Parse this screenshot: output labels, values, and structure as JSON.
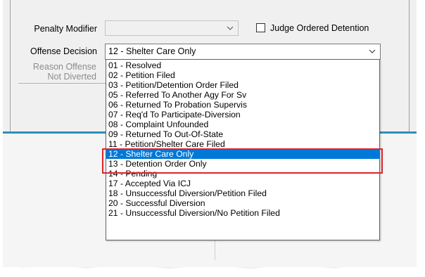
{
  "form": {
    "penalty_modifier_label": "Penalty Modifier",
    "penalty_modifier_value": "",
    "judge_ordered_label": "Judge Ordered Detention",
    "offense_decision_label": "Offense Decision",
    "offense_decision_value": "12 - Shelter Care Only",
    "reason_label_line1": "Reason Offense",
    "reason_label_line2": "Not Diverted"
  },
  "dropdown": {
    "items": [
      "01 - Resolved",
      "02 - Petition Filed",
      "03 - Petition/Detention Order Filed",
      "05 - Referred To Another Agy For Sv",
      "06 - Returned To Probation Supervis",
      "07 - Req'd To Participate-Diversion",
      "08 - Complaint Unfounded",
      "09 - Returned To Out-Of-State",
      "11 - Petition/Shelter Care Filed",
      "12 - Shelter Care Only",
      "13 - Detention Order Only",
      "14 - Pending",
      "17 - Accepted Via ICJ",
      "18 - Unsuccessful Diversion/Petition Filed",
      "20 - Successful Diversion",
      "21 - Unsuccessful Diversion/No Petition Filed"
    ],
    "selected_index": 9
  },
  "colors": {
    "selection": "#0078d7",
    "highlight_border": "#e0232b",
    "accent_line": "#2f8fb8"
  },
  "icons": {
    "combo_arrow": "chevron-down-icon"
  }
}
